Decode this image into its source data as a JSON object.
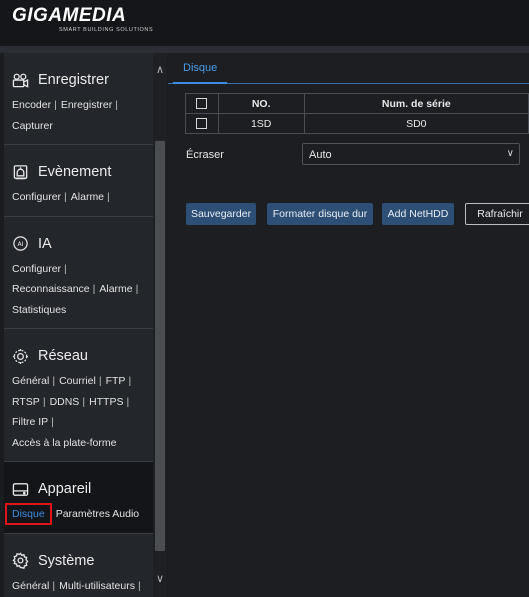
{
  "brand": {
    "name": "GIGAMEDIA",
    "tagline": "SMART BUILDING SOLUTIONS"
  },
  "sidebar": {
    "sections": [
      {
        "title": "Enregistrer",
        "icon": "record-icon",
        "links": [
          [
            "Encoder",
            "Enregistrer"
          ],
          [
            "Capturer"
          ]
        ]
      },
      {
        "title": "Evènement",
        "icon": "alarm-icon",
        "links": [
          [
            "Configurer",
            "Alarme"
          ]
        ]
      },
      {
        "title": "IA",
        "icon": "ai-icon",
        "links": [
          [
            "Configurer"
          ],
          [
            "Reconnaissance",
            "Alarme"
          ],
          [
            "Statistiques"
          ]
        ]
      },
      {
        "title": "Réseau",
        "icon": "network-icon",
        "links": [
          [
            "Général",
            "Courriel",
            "FTP"
          ],
          [
            "RTSP",
            "DDNS",
            "HTTPS"
          ],
          [
            "Filtre IP"
          ],
          [
            "Accès à la plate-forme"
          ]
        ]
      },
      {
        "title": "Appareil",
        "icon": "hdd-icon",
        "links": [
          [
            "Disque",
            "Paramètres Audio"
          ]
        ],
        "selected": "Disque"
      },
      {
        "title": "Système",
        "icon": "gear-icon",
        "links": [
          [
            "Général",
            "Multi-utilisateurs"
          ]
        ]
      }
    ]
  },
  "main": {
    "tab": "Disque",
    "table": {
      "headers": [
        "NO.",
        "Num. de série"
      ],
      "rows": [
        {
          "no": "1SD",
          "serial": "SD0"
        }
      ]
    },
    "overwrite": {
      "label": "Écraser",
      "value": "Auto"
    },
    "buttons": {
      "save": "Sauvegarder",
      "format": "Formater disque dur",
      "add_nethdd": "Add NetHDD",
      "refresh": "Rafraîchir"
    }
  },
  "colors": {
    "accent": "#3d8de0",
    "button": "#2d4f76",
    "selection_outline": "#e0141a"
  }
}
